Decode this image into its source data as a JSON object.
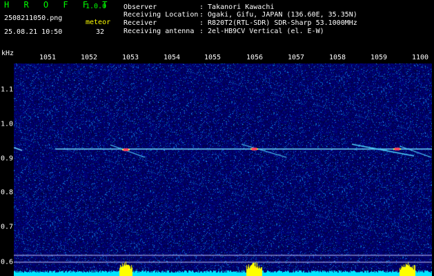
{
  "header": {
    "app_title": "H R O F F T",
    "version": "1.0.0",
    "file_name": "2508211050.png",
    "date_time": "25.08.21 10:50",
    "mode_label": "meteor",
    "mode_count": "32",
    "rows": [
      {
        "label": "Observer",
        "value": ": Takanori Kawachi"
      },
      {
        "label": "Receiving Location",
        "value": ": Ogaki, Gifu, JAPAN (136.60E, 35.35N)"
      },
      {
        "label": "Receiver",
        "value": ": R820T2(RTL-SDR) SDR-Sharp 53.1000MHz"
      },
      {
        "label": "Receiving antenna",
        "value": ": 2el-HB9CV Vertical (el. E-W)"
      }
    ]
  },
  "time_axis": {
    "labels": [
      "1051",
      "1052",
      "1053",
      "1054",
      "1055",
      "1056",
      "1057",
      "1058",
      "1059",
      "1100"
    ]
  },
  "freq_axis": {
    "unit": "kHz",
    "labels": [
      "1.1",
      "1.0",
      "0.9",
      "0.8",
      "0.7",
      "0.6"
    ]
  },
  "colors": {
    "background": "#000000",
    "text_green": "#00ff00",
    "text_white": "#ffffff",
    "text_yellow": "#ffff00",
    "noise_base": "#000a5a",
    "carrier": "#6fdcff",
    "echo_peak": "#ff4060",
    "bottom_trace": "#00e5ff",
    "bottom_peak": "#ffff00"
  }
}
